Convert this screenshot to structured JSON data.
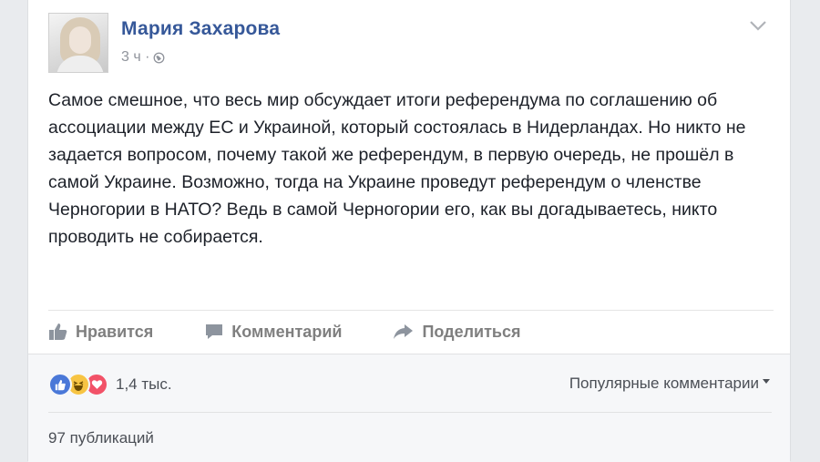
{
  "post": {
    "author_name": "Мария Захарова",
    "timestamp": "3 ч ·",
    "privacy_icon": "globe-icon",
    "text": "Самое смешное, что весь мир обсуждает итоги референдума по соглашению об ассоциации между ЕС и Украиной, который состоялась в Нидерландах. Но никто не задается вопросом, почему такой же референдум, в первую очередь, не прошёл в самой Украине. Возможно, тогда на Украине проведут референдум о членстве Черногории в НАТО? Ведь в самой Черногории его, как вы догадываетесь, никто проводить не собирается."
  },
  "actions": {
    "like_label": "Нравится",
    "comment_label": "Комментарий",
    "share_label": "Поделиться"
  },
  "reactions": {
    "types": [
      "like",
      "haha",
      "love"
    ],
    "count": "1,4 тыс."
  },
  "comments": {
    "sort_label": "Популярные комментарии"
  },
  "shares": {
    "label": "97 публикаций"
  },
  "colors": {
    "name_link": "#365899",
    "page_bg": "#e9ebee",
    "like_blue": "#4a78d8",
    "haha_yellow": "#f7c443",
    "love_red": "#f25268"
  }
}
